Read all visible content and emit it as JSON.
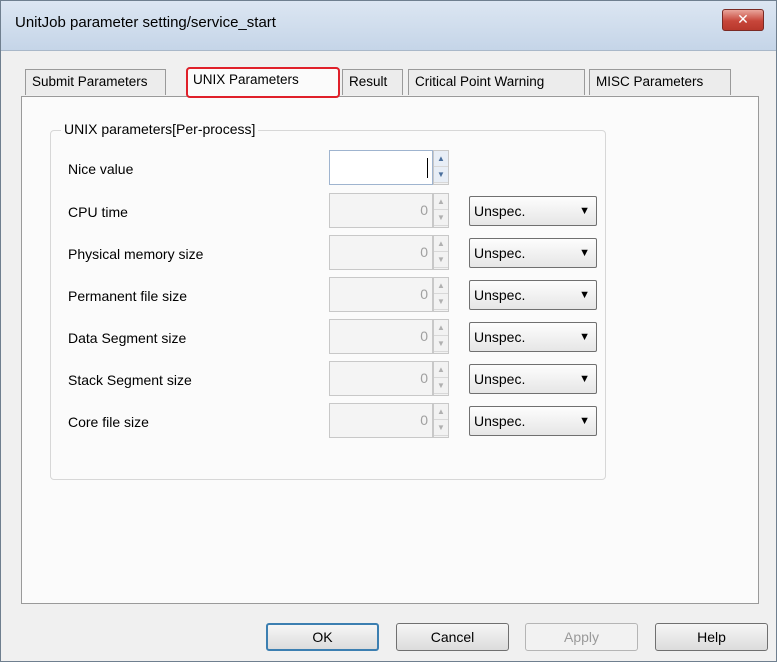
{
  "window": {
    "title": "UnitJob parameter setting/service_start",
    "close_glyph": "✕"
  },
  "tabs": [
    {
      "label": "Submit Parameters",
      "active": false
    },
    {
      "label": "UNIX Parameters",
      "active": true
    },
    {
      "label": "Result",
      "active": false
    },
    {
      "label": "Critical Point Warning",
      "active": false
    },
    {
      "label": "MISC Parameters",
      "active": false
    }
  ],
  "group": {
    "title": "UNIX parameters[Per-process]",
    "rows": [
      {
        "label": "Nice value",
        "value": "",
        "has_unit": false,
        "unit": ""
      },
      {
        "label": "CPU time",
        "value": "0",
        "has_unit": true,
        "unit": "Unspec."
      },
      {
        "label": "Physical memory size",
        "value": "0",
        "has_unit": true,
        "unit": "Unspec."
      },
      {
        "label": "Permanent file size",
        "value": "0",
        "has_unit": true,
        "unit": "Unspec."
      },
      {
        "label": "Data Segment size",
        "value": "0",
        "has_unit": true,
        "unit": "Unspec."
      },
      {
        "label": "Stack Segment size",
        "value": "0",
        "has_unit": true,
        "unit": "Unspec."
      },
      {
        "label": "Core file size",
        "value": "0",
        "has_unit": true,
        "unit": "Unspec."
      }
    ]
  },
  "buttons": {
    "ok": "OK",
    "cancel": "Cancel",
    "apply": "Apply",
    "help": "Help"
  },
  "icons": {
    "spin_up": "▲",
    "spin_down": "▼",
    "dropdown": "▼"
  },
  "colors": {
    "highlight": "#e0202a",
    "titlebar": "#c5d5e8"
  }
}
